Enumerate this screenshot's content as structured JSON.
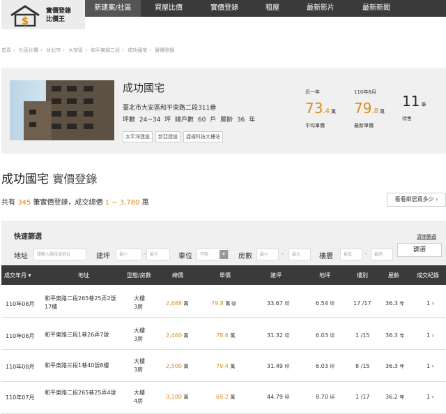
{
  "logo": {
    "line1": "實價登錄",
    "line2": "比價王",
    "symbol": "$"
  },
  "nav": [
    {
      "label": "新建案/社區",
      "active": true
    },
    {
      "label": "買屋比價",
      "active": false
    },
    {
      "label": "實價登錄",
      "active": false
    },
    {
      "label": "租屋",
      "active": false
    },
    {
      "label": "最新影片",
      "active": false
    },
    {
      "label": "最新新聞",
      "active": false
    }
  ],
  "breadcrumb": [
    "首頁",
    "社區比價",
    "台北市",
    "大安區",
    "和平東路二段",
    "成功國宅",
    "實價登錄"
  ],
  "building": {
    "name": "成功國宅",
    "address": "臺北市大安區和平東路二段311巷",
    "meta": "坪數 24~34 坪  總戶數 60 戶  屋齡 36 年",
    "tags": [
      "太平洋建設",
      "新亞建設",
      "捷運科技大樓站"
    ]
  },
  "stats": {
    "avg": {
      "label": "近一年",
      "int": "73",
      "dec": ".4",
      "unit": "萬",
      "caption": "平均單價"
    },
    "latest": {
      "label": "110年8月",
      "int": "79",
      "dec": ".8",
      "unit": "萬",
      "caption": "最新單價"
    },
    "selling": {
      "label": "",
      "value": "11",
      "unit": "筆",
      "caption": "待售"
    }
  },
  "section": {
    "title": "成功國宅",
    "subtitle": "實價登錄"
  },
  "summary": {
    "prefix": "共有",
    "count": "345",
    "mid": "筆實價登錄，成交總價",
    "range": "1 ~ 3,780",
    "suffix": "萬"
  },
  "nearby_button": "看看鄰居買多少 ›",
  "filter": {
    "title": "快速篩選",
    "clear": "清除篩選",
    "button": "篩選",
    "address_label": "地址",
    "address_placeholder": "請輸入路段或地址",
    "area_label": "建坪",
    "area_min": "最小",
    "area_max": "最大",
    "parking_label": "車位",
    "parking_value": "不限",
    "rooms_label": "房數",
    "rooms_min": "最小",
    "rooms_max": "最大",
    "floor_label": "樓層",
    "floor_min": "最低",
    "floor_max": "最高",
    "dash": "-"
  },
  "table": {
    "headers": [
      "成交年月 ▾",
      "地址",
      "型態/房數",
      "總價",
      "單價",
      "建坪",
      "地坪",
      "樓別",
      "屋齡",
      "成交紀錄"
    ],
    "rows": [
      {
        "date": "110年08月",
        "address": "和平東路二段265巷25弄2號17樓",
        "type": "大樓",
        "rooms": "3房",
        "total": "2,688",
        "total_unit": "萬",
        "unit_price": "79.8",
        "unit_price_unit": "萬",
        "has_info": true,
        "area": "33.67",
        "area_unit": "坪",
        "land": "6.54",
        "land_unit": "坪",
        "floor": "17 /17",
        "age": "36.3",
        "age_unit": "年",
        "records": "1 ›"
      },
      {
        "date": "110年08月",
        "address": "和平東路三段1巷26弄7號",
        "type": "大樓",
        "rooms": "3房",
        "total": "2,460",
        "total_unit": "萬",
        "unit_price": "78.6",
        "unit_price_unit": "萬",
        "has_info": false,
        "area": "31.32",
        "area_unit": "坪",
        "land": "6.03",
        "land_unit": "坪",
        "floor": "1 /15",
        "age": "36.3",
        "age_unit": "年",
        "records": "1 ›"
      },
      {
        "date": "110年08月",
        "address": "和平東路三段1巷40號8樓",
        "type": "大樓",
        "rooms": "3房",
        "total": "2,500",
        "total_unit": "萬",
        "unit_price": "79.4",
        "unit_price_unit": "萬",
        "has_info": false,
        "area": "31.49",
        "area_unit": "坪",
        "land": "6.03",
        "land_unit": "坪",
        "floor": "8 /15",
        "age": "36.3",
        "age_unit": "年",
        "records": "1 ›"
      },
      {
        "date": "110年07月",
        "address": "和平東路二段265巷25弄4號",
        "type": "大樓",
        "rooms": "4房",
        "total": "3,100",
        "total_unit": "萬",
        "unit_price": "69.2",
        "unit_price_unit": "萬",
        "has_info": false,
        "area": "44.79",
        "area_unit": "坪",
        "land": "8.70",
        "land_unit": "坪",
        "floor": "1 /17",
        "age": "36.2",
        "age_unit": "年",
        "records": "1 ›"
      }
    ]
  },
  "colors": {
    "accent": "#d98a1c",
    "nav_bg": "#3a3a3a",
    "panel_bg": "#f0f0f0"
  }
}
